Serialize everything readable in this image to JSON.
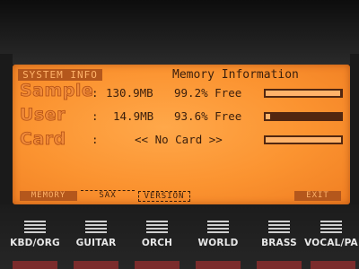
{
  "screen": {
    "tab_header": "SYSTEM INFO",
    "title": "Memory Information",
    "rows": [
      {
        "label": "Sample",
        "sep": ":",
        "size": "130.9MB",
        "free": "99.2% Free",
        "meter_fill": 0.99
      },
      {
        "label": "User",
        "sep": ":",
        "size": "14.9MB",
        "free": "93.6% Free",
        "meter_fill": 0.06
      },
      {
        "label": "Card",
        "sep": ":",
        "message": "<< No Card >>",
        "meter_fill": 1.0
      }
    ],
    "soft_buttons": {
      "memory": "MEMORY",
      "sax": "SAX",
      "version": "VERSION",
      "exit": "EXIT"
    }
  },
  "panel_buttons": [
    {
      "label": "KBD/ORG"
    },
    {
      "label": "GUITAR"
    },
    {
      "label": "ORCH"
    },
    {
      "label": "WORLD"
    },
    {
      "label": "BRASS"
    },
    {
      "label": "VOCAL/PA"
    }
  ],
  "colors": {
    "lcd_backlight": "#fb9330",
    "lcd_text": "#3a1e0c",
    "highlight_block": "#b4571c",
    "button_foot": "#7b2c2c"
  }
}
